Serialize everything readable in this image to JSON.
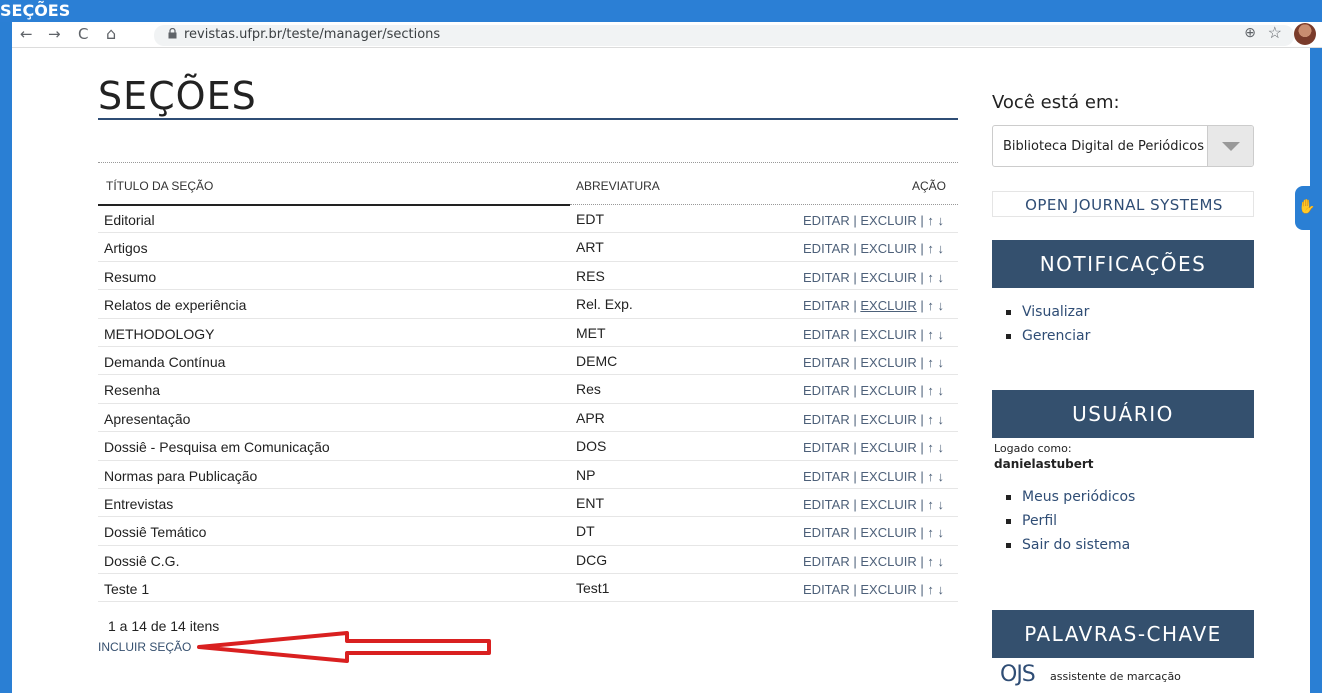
{
  "top_strip": {
    "text": "SEÇÕES"
  },
  "browser": {
    "back": "←",
    "forward": "→",
    "reload": "C",
    "home": "⌂",
    "url": "revistas.ufpr.br/teste/manager/sections",
    "zoom_icon": "⊕",
    "star_icon": "☆"
  },
  "page": {
    "title": "SEÇÕES",
    "table": {
      "headers": {
        "title": "TÍTULO DA SEÇÃO",
        "abbr": "ABREVIATURA",
        "action": "AÇÃO"
      },
      "action_labels": {
        "edit": "EDITAR",
        "delete": "EXCLUIR",
        "sep": "|",
        "up": "↑",
        "down": "↓"
      },
      "rows": [
        {
          "title": "Editorial",
          "abbr": "EDT"
        },
        {
          "title": "Artigos",
          "abbr": "ART"
        },
        {
          "title": "Resumo",
          "abbr": "RES"
        },
        {
          "title": "Relatos de experiência",
          "abbr": "Rel. Exp."
        },
        {
          "title": "METHODOLOGY",
          "abbr": "MET"
        },
        {
          "title": "Demanda Contínua",
          "abbr": "DEMC"
        },
        {
          "title": "Resenha",
          "abbr": "Res"
        },
        {
          "title": "Apresentação",
          "abbr": "APR"
        },
        {
          "title": "Dossiê - Pesquisa em Comunicação",
          "abbr": "DOS"
        },
        {
          "title": "Normas para Publicação",
          "abbr": "NP"
        },
        {
          "title": "Entrevistas",
          "abbr": "ENT"
        },
        {
          "title": "Dossiê Temático",
          "abbr": "DT"
        },
        {
          "title": "Dossiê C.G.",
          "abbr": "DCG"
        },
        {
          "title": "Teste 1",
          "abbr": "Test1"
        }
      ]
    },
    "items_count": "1 a 14 de 14 itens",
    "add_section": "INCLUIR SEÇÃO"
  },
  "sidebar": {
    "you_are_in": "Você está em:",
    "journal_selected": "Biblioteca Digital de Periódicos",
    "ojs_link": "OPEN JOURNAL SYSTEMS",
    "notifications": {
      "title": "NOTIFICAÇÕES",
      "items": [
        "Visualizar",
        "Gerenciar"
      ]
    },
    "user": {
      "title": "USUÁRIO",
      "logged_as": "Logado como:",
      "username": "danielastubert",
      "items": [
        "Meus periódicos",
        "Perfil",
        "Sair do sistema"
      ]
    },
    "keywords": {
      "title": "PALAVRAS-CHAVE",
      "logo": "OJS",
      "subtitle": "assistente de marcação"
    }
  },
  "colors": {
    "accent": "#34506e",
    "frame_blue": "#2a7fd4",
    "arrow_red": "#d92020"
  }
}
